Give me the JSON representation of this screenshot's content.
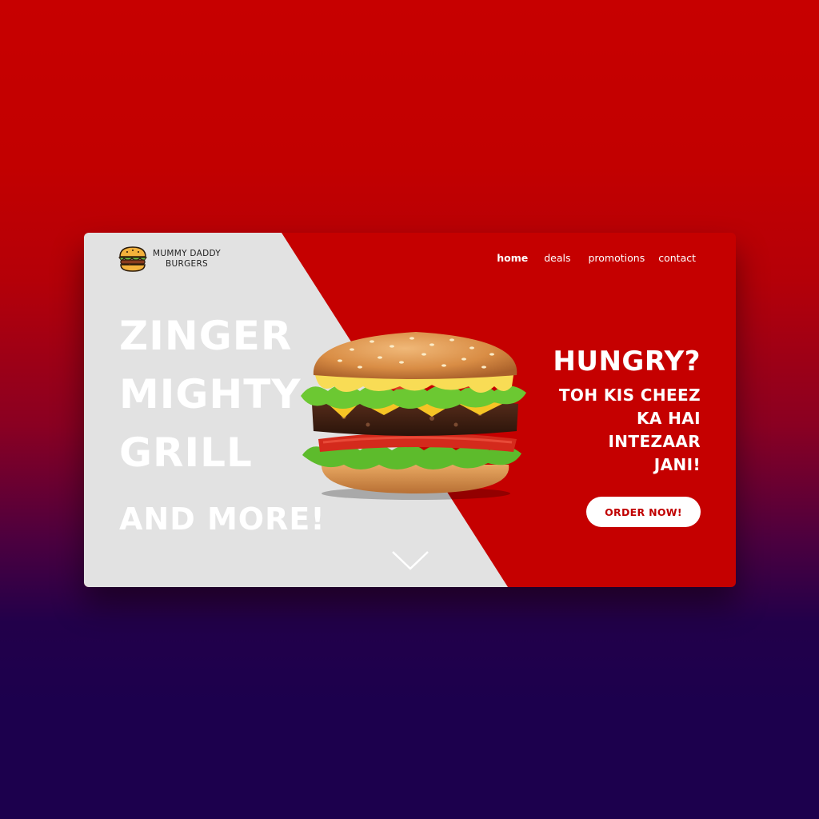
{
  "brand": {
    "name_line1": "MUMMY DADDY",
    "name_line2": "BURGERS",
    "logo_icon": "burger-icon"
  },
  "nav": {
    "items": [
      {
        "label": "home",
        "active": true
      },
      {
        "label": "deals",
        "active": false
      },
      {
        "label": "promotions",
        "active": false
      },
      {
        "label": "contact",
        "active": false
      }
    ]
  },
  "hero": {
    "line1": "ZINGER",
    "line2": "MIGHTY",
    "line3": "GRILL",
    "line4": "AND MORE!"
  },
  "tagline": {
    "headline": "HUNGRY?",
    "line1": "TOH KIS CHEEZ",
    "line2": "KA HAI",
    "line3": "INTEZAAR",
    "line4": "JANI!"
  },
  "cta": {
    "order_label": "ORDER NOW!"
  },
  "scroll_icon": "chevron-down-icon",
  "colors": {
    "primary_red": "#c50000",
    "panel_grey": "#e2e2e2",
    "background_purple": "#1c004d",
    "white": "#ffffff"
  }
}
